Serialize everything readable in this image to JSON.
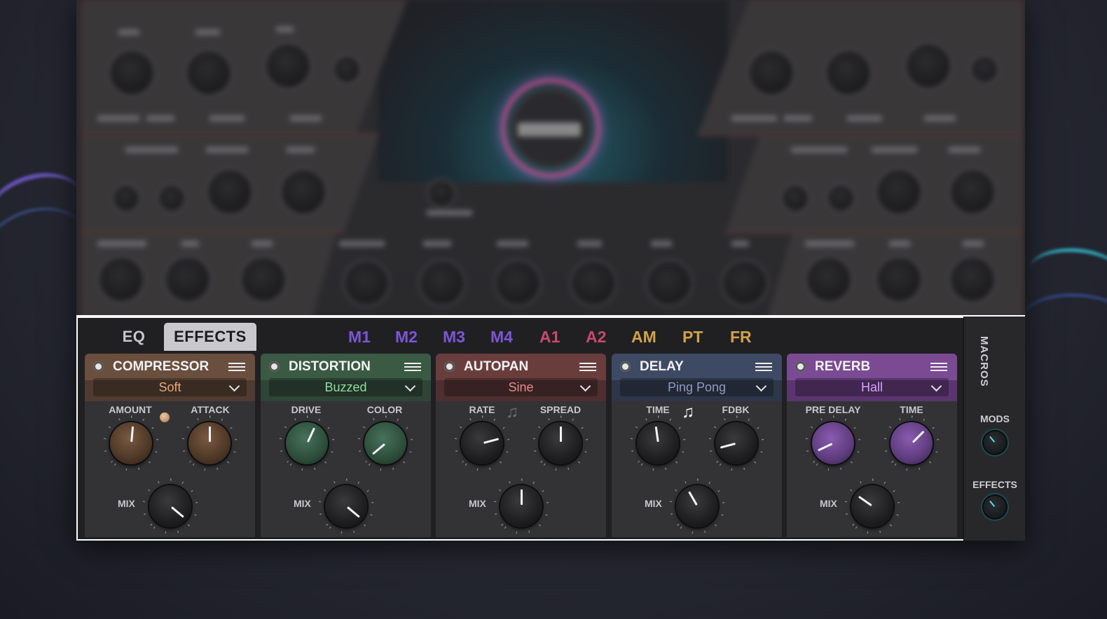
{
  "colors": {
    "compressor": "#6a4e3e",
    "distortion": "#3a5a43",
    "autopan": "#6a3d3d",
    "delay": "#3e4a63",
    "reverb": "#7a4a93",
    "mtab": "#7b56d6",
    "atab": "#c84a6b",
    "ptab": "#d1a24a"
  },
  "tabs": {
    "eq": "EQ",
    "effects": "EFFECTS",
    "mod": [
      "M1",
      "M2",
      "M3",
      "M4",
      "A1",
      "A2",
      "AM",
      "PT",
      "FR"
    ]
  },
  "slots": [
    {
      "title": "COMPRESSOR",
      "mode": "Soft",
      "k1": "AMOUNT",
      "k2": "ATTACK",
      "k3": "MIX"
    },
    {
      "title": "DISTORTION",
      "mode": "Buzzed",
      "k1": "DRIVE",
      "k2": "COLOR",
      "k3": "MIX"
    },
    {
      "title": "AUTOPAN",
      "mode": "Sine",
      "k1": "RATE",
      "k2": "SPREAD",
      "k3": "MIX"
    },
    {
      "title": "DELAY",
      "mode": "Ping Pong",
      "k1": "TIME",
      "k2": "FDBK",
      "k3": "MIX"
    },
    {
      "title": "REVERB",
      "mode": "Hall",
      "k1": "PRE DELAY",
      "k2": "TIME",
      "k3": "MIX"
    }
  ],
  "macros": {
    "title": "MACROS",
    "mods": "MODS",
    "effects": "EFFECTS"
  },
  "icons": {
    "menu": "hamburger-icon",
    "dropdown": "chevron-down-icon",
    "power": "power-icon",
    "sync": "music-note-icon"
  }
}
